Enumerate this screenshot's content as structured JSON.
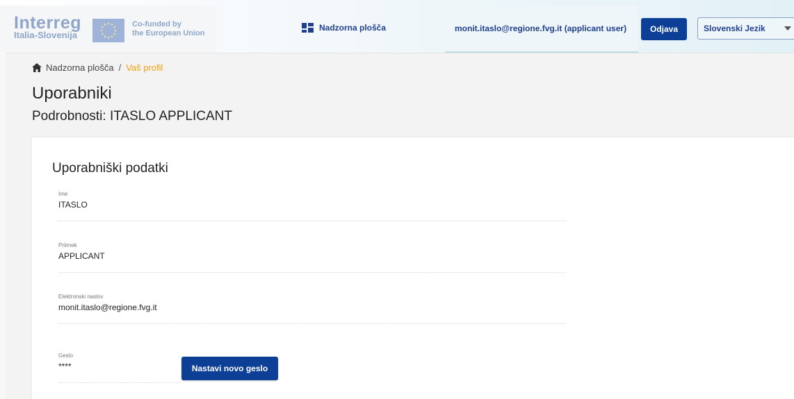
{
  "header": {
    "logo_main": "Interreg",
    "logo_sub": "Italia-Slovenija",
    "eu_line1": "Co-funded by",
    "eu_line2": "the European Union",
    "dashboard_label": "Nadzorna plošča",
    "user_label": "monit.itaslo@regione.fvg.it (applicant user)",
    "logout_label": "Odjava",
    "language_selected": "Slovenski Jezik"
  },
  "breadcrumb": {
    "home_label": "Nadzorna plošča",
    "separator": "/",
    "current_label": "Vaš profil"
  },
  "page": {
    "title": "Uporabniki",
    "subtitle": "Podrobnosti: ITASLO APPLICANT"
  },
  "card": {
    "title": "Uporabniški podatki",
    "fields": [
      {
        "label": "Ime",
        "value": "ITASLO"
      },
      {
        "label": "Priimek",
        "value": "APPLICANT"
      },
      {
        "label": "Elektronski naslov",
        "value": "monit.itaslo@regione.fvg.it"
      },
      {
        "label": "Geslo",
        "value": "****"
      }
    ],
    "new_password_label": "Nastavi novo geslo"
  },
  "colors": {
    "primary": "#0c3f95",
    "accent": "#f2a20c",
    "background": "#f3f3f3"
  },
  "icons": [
    "eu-flag-icon",
    "dashboard-grid-icon",
    "chevron-down-icon",
    "home-icon"
  ]
}
